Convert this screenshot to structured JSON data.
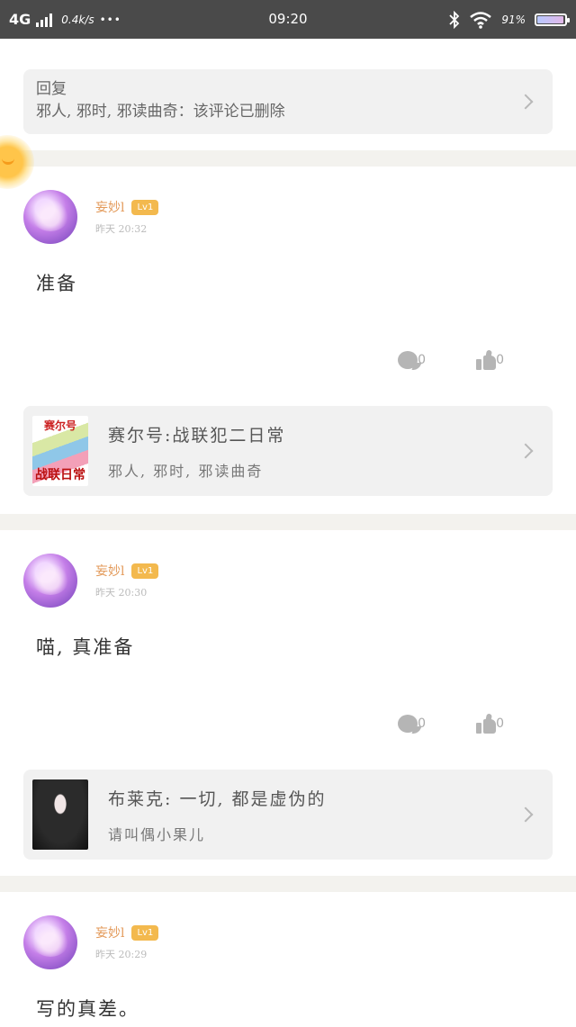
{
  "status_bar": {
    "network": "4G",
    "speed": "0.4k/s",
    "dots": "•••",
    "time": "09:20",
    "battery_percent": "91%",
    "battery_level": 0.91
  },
  "reply_card": {
    "title": "回复",
    "text": "邪人, 邪时, 邪读曲奇：该评论已删除"
  },
  "posts": [
    {
      "username": "妄妙l",
      "level": "Lv1",
      "time": "昨天 20:32",
      "content": "准备",
      "comments": "0",
      "likes": "0",
      "topic": {
        "title": "赛尔号:战联犯二日常",
        "subtitle": "邪人, 邪时, 邪读曲奇",
        "image_top": "赛尔号",
        "image_bottom": "战联日常"
      }
    },
    {
      "username": "妄妙l",
      "level": "Lv1",
      "time": "昨天 20:30",
      "content": "喵, 真准备",
      "comments": "0",
      "likes": "0",
      "topic": {
        "title": "布莱克: 一切, 都是虚伪的",
        "subtitle": "请叫偶小果儿"
      }
    },
    {
      "username": "妄妙l",
      "level": "Lv1",
      "time": "昨天 20:29",
      "content": "写的真差。"
    }
  ]
}
